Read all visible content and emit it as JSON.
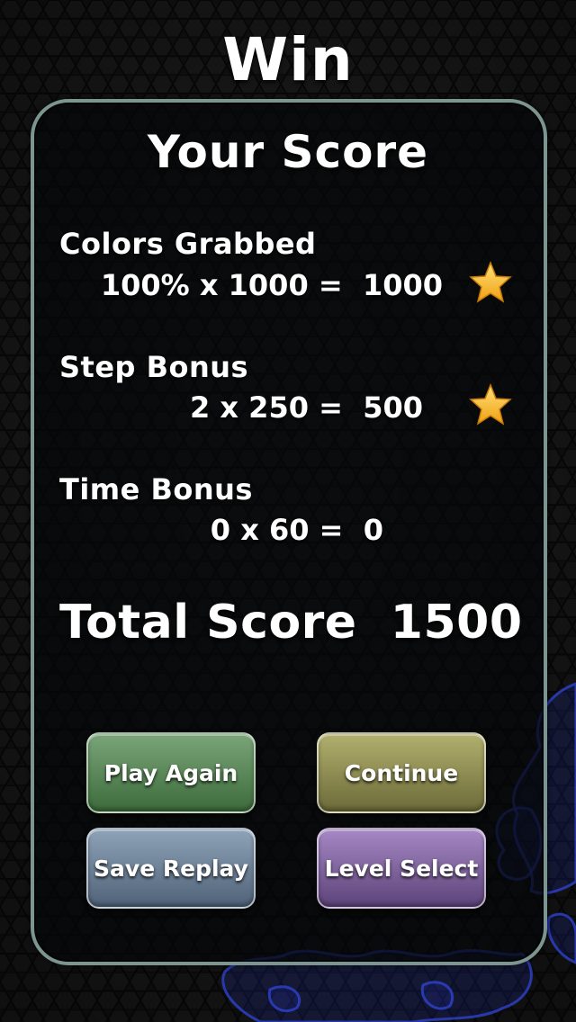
{
  "title": "Win",
  "heading": "Your Score",
  "rows": [
    {
      "label": "Colors Grabbed",
      "calc": "100% x 1000 =  1000",
      "star": true
    },
    {
      "label": "Step Bonus",
      "calc": "2 x 250 =  500",
      "star": true
    },
    {
      "label": "Time Bonus",
      "calc": "0 x 60 =  0",
      "star": false
    }
  ],
  "total": "Total Score  1500",
  "buttons": {
    "play_again": "Play Again",
    "continue": "Continue",
    "save_replay": "Save Replay",
    "level_select": "Level Select"
  },
  "colors": {
    "panel_border": "#7c9590",
    "star": "#f5b81c",
    "play_again": "#5a8a58",
    "continue": "#8f8d52",
    "save_replay": "#6e8299",
    "level_select": "#7e61a0",
    "blob": "#2a3cc8"
  },
  "icons": [
    "star-icon"
  ]
}
